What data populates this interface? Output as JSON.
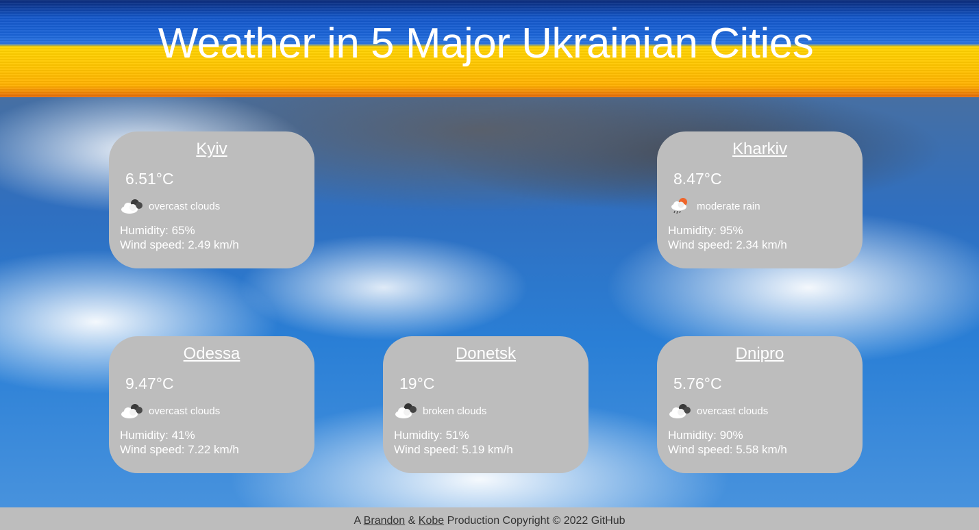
{
  "header": {
    "title": "Weather in 5 Major Ukrainian Cities"
  },
  "cards": [
    {
      "city": "Kyiv",
      "temp": "6.51°C",
      "icon": "overcast-clouds-icon",
      "condition": "overcast clouds",
      "humidity": "Humidity: 65%",
      "wind": "Wind speed: 2.49 km/h"
    },
    {
      "city": "Kharkiv",
      "temp": "8.47°C",
      "icon": "moderate-rain-icon",
      "condition": "moderate rain",
      "humidity": "Humidity: 95%",
      "wind": "Wind speed: 2.34 km/h"
    },
    {
      "city": "Odessa",
      "temp": "9.47°C",
      "icon": "overcast-clouds-icon",
      "condition": "overcast clouds",
      "humidity": "Humidity: 41%",
      "wind": "Wind speed: 7.22 km/h"
    },
    {
      "city": "Donetsk",
      "temp": "19°C",
      "icon": "broken-clouds-icon",
      "condition": "broken clouds",
      "humidity": "Humidity: 51%",
      "wind": "Wind speed: 5.19 km/h"
    },
    {
      "city": "Dnipro",
      "temp": "5.76°C",
      "icon": "overcast-clouds-icon",
      "condition": "overcast clouds",
      "humidity": "Humidity: 90%",
      "wind": "Wind speed: 5.58 km/h"
    }
  ],
  "footer": {
    "prefix": "A",
    "author1": "Brandon",
    "amp": "&",
    "author2": "Kobe",
    "suffix": "Production Copyright © 2022 GitHub"
  },
  "colors": {
    "card_bg": "#bdbdbd",
    "footer_bg": "#bdbdbd",
    "text": "#ffffff",
    "rain_sun_accent": "#f0652a"
  }
}
